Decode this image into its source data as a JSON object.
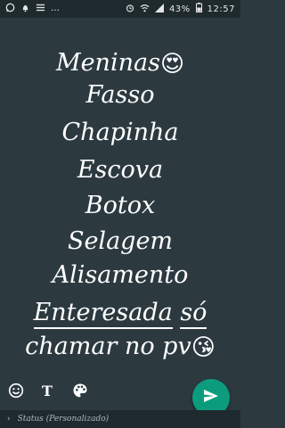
{
  "status_bar": {
    "left_icons": [
      "whatsapp-icon",
      "notification-icon",
      "list-icon"
    ],
    "ellipsis": "…",
    "battery_percent": "43%",
    "time": "12:57"
  },
  "compose": {
    "lines": [
      {
        "text": "Meninas",
        "emoji": "😍"
      },
      {
        "text": "Fasso"
      },
      {
        "text": "Chapinha"
      },
      {
        "text": "Escova"
      },
      {
        "text": "Botox"
      },
      {
        "text": "Selagem"
      },
      {
        "text": "Alisamento"
      },
      {
        "part1": "Enteresada",
        "part2": "só"
      },
      {
        "text": "chamar no pv",
        "emoji": "😘"
      }
    ]
  },
  "toolbar": {
    "text_tool": "T",
    "icons": [
      "emoji-icon",
      "text-icon",
      "palette-icon"
    ]
  },
  "send": {
    "icon": "send-icon",
    "accent": "#0b9c7e"
  },
  "footer": {
    "chevron": "›",
    "label": "Status (Personalizado)"
  }
}
